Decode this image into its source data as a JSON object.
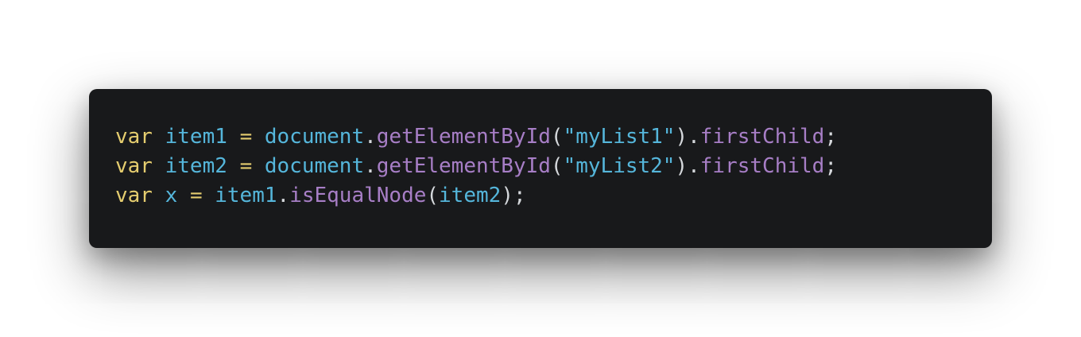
{
  "colors": {
    "background": "#ffffff",
    "panel": "#18191b",
    "keyword": "#e5cd6f",
    "identifier": "#55b6db",
    "method": "#a77ec6",
    "string": "#55b6db",
    "punctuation": "#d5d8dc",
    "operator": "#e5cd6f"
  },
  "code": {
    "lines": [
      [
        {
          "t": "var",
          "k": "keyword"
        },
        {
          "t": " ",
          "k": "punctuation"
        },
        {
          "t": "item1",
          "k": "identifier"
        },
        {
          "t": " ",
          "k": "punctuation"
        },
        {
          "t": "=",
          "k": "operator"
        },
        {
          "t": " ",
          "k": "punctuation"
        },
        {
          "t": "document",
          "k": "identifier"
        },
        {
          "t": ".",
          "k": "punctuation"
        },
        {
          "t": "getElementById",
          "k": "method"
        },
        {
          "t": "(",
          "k": "punctuation"
        },
        {
          "t": "\"myList1\"",
          "k": "string"
        },
        {
          "t": ").",
          "k": "punctuation"
        },
        {
          "t": "firstChild",
          "k": "method"
        },
        {
          "t": ";",
          "k": "punctuation"
        }
      ],
      [
        {
          "t": "var",
          "k": "keyword"
        },
        {
          "t": " ",
          "k": "punctuation"
        },
        {
          "t": "item2",
          "k": "identifier"
        },
        {
          "t": " ",
          "k": "punctuation"
        },
        {
          "t": "=",
          "k": "operator"
        },
        {
          "t": " ",
          "k": "punctuation"
        },
        {
          "t": "document",
          "k": "identifier"
        },
        {
          "t": ".",
          "k": "punctuation"
        },
        {
          "t": "getElementById",
          "k": "method"
        },
        {
          "t": "(",
          "k": "punctuation"
        },
        {
          "t": "\"myList2\"",
          "k": "string"
        },
        {
          "t": ").",
          "k": "punctuation"
        },
        {
          "t": "firstChild",
          "k": "method"
        },
        {
          "t": ";",
          "k": "punctuation"
        }
      ],
      [
        {
          "t": "var",
          "k": "keyword"
        },
        {
          "t": " ",
          "k": "punctuation"
        },
        {
          "t": "x",
          "k": "identifier"
        },
        {
          "t": " ",
          "k": "punctuation"
        },
        {
          "t": "=",
          "k": "operator"
        },
        {
          "t": " ",
          "k": "punctuation"
        },
        {
          "t": "item1",
          "k": "identifier"
        },
        {
          "t": ".",
          "k": "punctuation"
        },
        {
          "t": "isEqualNode",
          "k": "method"
        },
        {
          "t": "(",
          "k": "punctuation"
        },
        {
          "t": "item2",
          "k": "identifier"
        },
        {
          "t": ");",
          "k": "punctuation"
        }
      ]
    ]
  }
}
